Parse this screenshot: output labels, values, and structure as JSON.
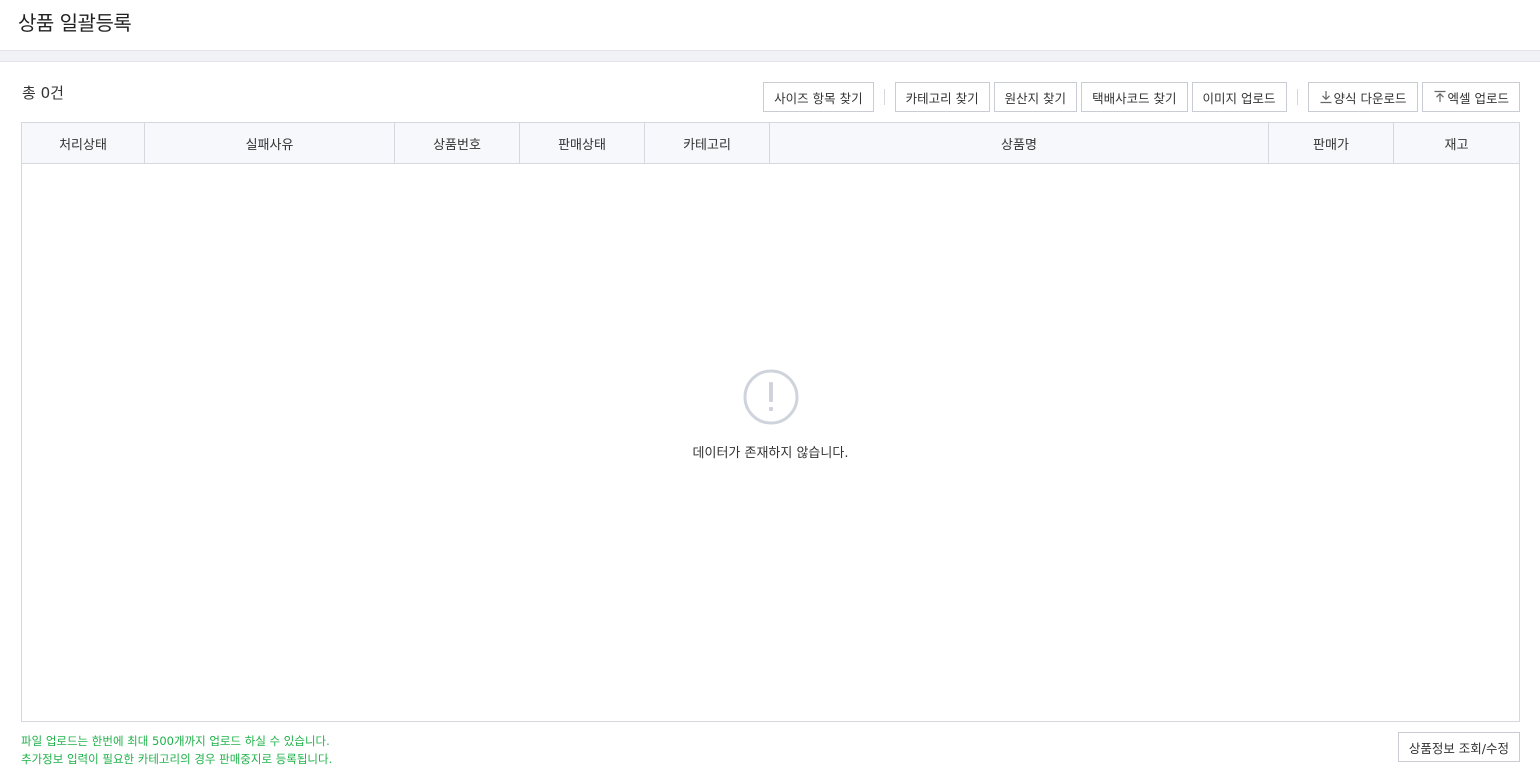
{
  "header": {
    "title": "상품 일괄등록"
  },
  "summary": {
    "total": "총 0건"
  },
  "toolbar": {
    "size_find": "사이즈 항목 찾기",
    "category_find": "카테고리 찾기",
    "origin_find": "원산지 찾기",
    "courier_find": "택배사코드 찾기",
    "image_upload": "이미지 업로드",
    "template_download": "양식 다운로드",
    "excel_upload": "엑셀 업로드"
  },
  "table": {
    "columns": [
      "처리상태",
      "실패사유",
      "상품번호",
      "판매상태",
      "카테고리",
      "상품명",
      "판매가",
      "재고"
    ],
    "rows": [],
    "empty_message": "데이터가 존재하지 않습니다."
  },
  "footer": {
    "notes": [
      "파일 업로드는 한번에 최대 500개까지 업로드 하실 수 있습니다.",
      "추가정보 입력이 필요한 카테고리의 경우 판매중지로 등록됩니다."
    ],
    "lookup_edit": "상품정보 조회/수정"
  },
  "colors": {
    "note_green": "#20b24a",
    "border": "#d5d8df",
    "header_bg": "#f7f8fb"
  },
  "icons": {
    "download": "download-icon",
    "upload": "upload-icon",
    "empty": "exclamation-circle-icon"
  }
}
